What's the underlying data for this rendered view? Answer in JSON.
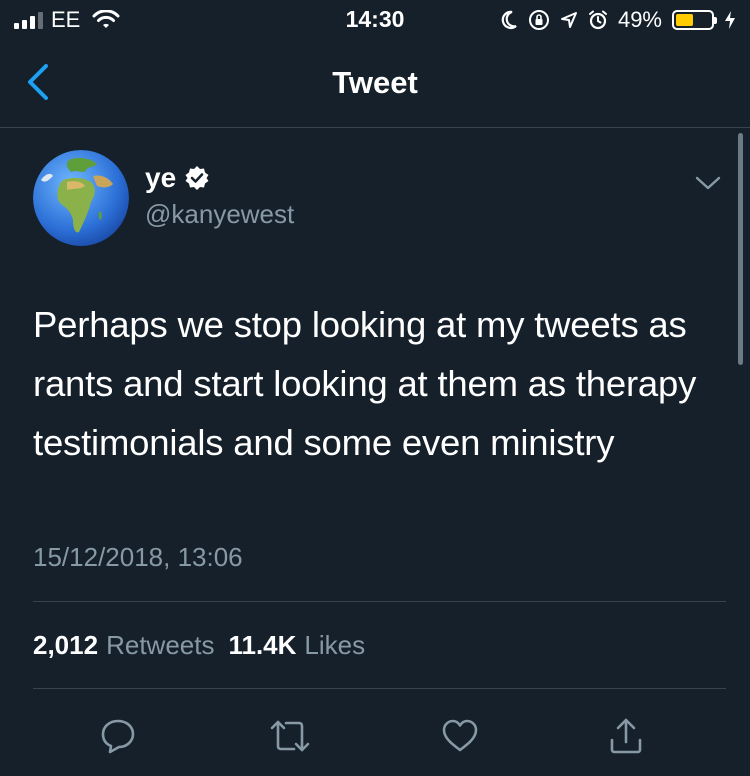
{
  "status_bar": {
    "carrier": "EE",
    "time": "14:30",
    "battery_percent_label": "49%",
    "battery_level": 0.49,
    "icons": [
      "signal-icon",
      "wifi-icon",
      "moon-icon",
      "orientation-lock-icon",
      "location-icon",
      "alarm-icon",
      "battery-icon",
      "charging-icon"
    ]
  },
  "nav": {
    "title": "Tweet",
    "back_icon": "chevron-left-icon"
  },
  "tweet": {
    "author_name": "ye",
    "verified": true,
    "handle": "@kanyewest",
    "avatar": "globe-avatar",
    "text": "Perhaps we stop looking at my tweets as rants and start looking at them as therapy testimonials and some even ministry",
    "timestamp": "15/12/2018, 13:06",
    "retweets_count": "2,012",
    "retweets_label": "Retweets",
    "likes_count": "11.4K",
    "likes_label": "Likes"
  },
  "actions": [
    "reply-icon",
    "retweet-icon",
    "like-icon",
    "share-icon"
  ],
  "colors": {
    "background": "#15202b",
    "accent": "#1da1f2",
    "secondary_text": "#8899a6",
    "divider": "#38444d",
    "battery": "#ffcc00"
  }
}
